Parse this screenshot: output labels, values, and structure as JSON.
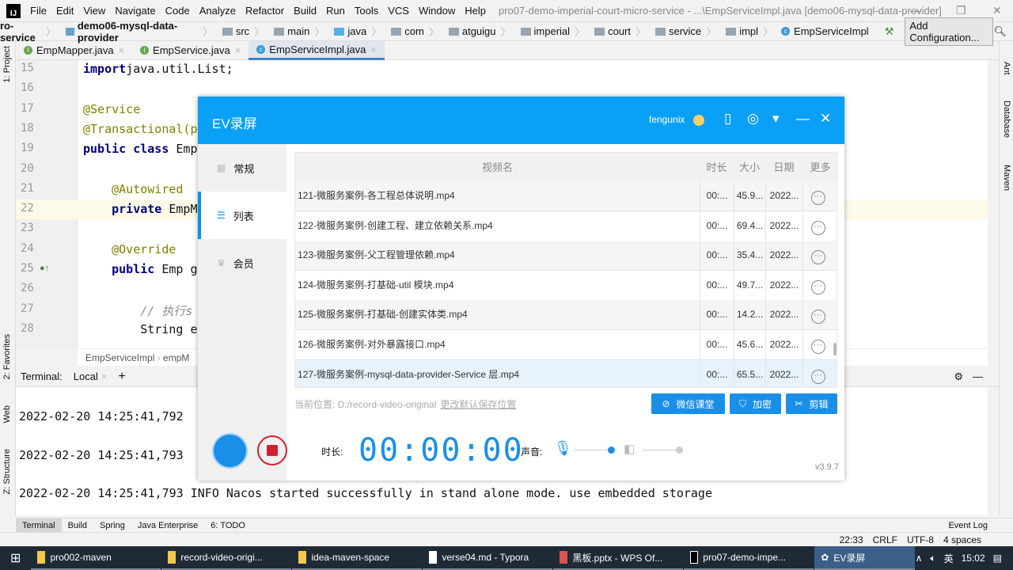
{
  "ide": {
    "menu": [
      "File",
      "Edit",
      "View",
      "Navigate",
      "Code",
      "Analyze",
      "Refactor",
      "Build",
      "Run",
      "Tools",
      "VCS",
      "Window",
      "Help"
    ],
    "window_title": "pro07-demo-imperial-court-micro-service - ...\\EmpServiceImpl.java [demo06-mysql-data-provider]",
    "breadcrumbs": [
      "ro-service",
      "demo06-mysql-data-provider",
      "src",
      "main",
      "java",
      "com",
      "atguigu",
      "imperial",
      "court",
      "service",
      "impl",
      "EmpServiceImpl"
    ],
    "add_configuration": "Add Configuration...",
    "tabs": [
      {
        "label": "EmpMapper.java",
        "color": "#6aa84f"
      },
      {
        "label": "EmpService.java",
        "color": "#6aa84f"
      },
      {
        "label": "EmpServiceImpl.java",
        "color": "#3d9ad6"
      }
    ],
    "left_tools": [
      "1: Project",
      "2: Favorites",
      "Web",
      "Z: Structure"
    ],
    "right_tools": [
      "Ant",
      "Database",
      "Maven"
    ],
    "code": [
      {
        "n": "15",
        "parts": [
          [
            "kw",
            "import"
          ],
          [
            "",
            "java.util.List;"
          ]
        ]
      },
      {
        "n": "16",
        "parts": []
      },
      {
        "n": "17",
        "parts": [
          [
            "ann",
            "@Service"
          ]
        ]
      },
      {
        "n": "18",
        "parts": [
          [
            "ann",
            "@Transactional(p"
          ]
        ]
      },
      {
        "n": "19",
        "parts": [
          [
            "kw",
            "public class"
          ],
          [
            "",
            " Emp"
          ]
        ]
      },
      {
        "n": "20",
        "parts": []
      },
      {
        "n": "21",
        "parts": [
          [
            "ann",
            "    @Autowired"
          ]
        ]
      },
      {
        "n": "22",
        "parts": [
          [
            "kw",
            "    private"
          ],
          [
            "",
            " EmpM"
          ]
        ]
      },
      {
        "n": "23",
        "parts": []
      },
      {
        "n": "24",
        "parts": [
          [
            "ann",
            "    @Override"
          ]
        ]
      },
      {
        "n": "25",
        "parts": [
          [
            "kw",
            "    public"
          ],
          [
            "",
            " Emp g"
          ]
        ]
      },
      {
        "n": "26",
        "parts": []
      },
      {
        "n": "27",
        "parts": [
          [
            "cmt",
            "        // 执行s"
          ]
        ]
      },
      {
        "n": "28",
        "parts": [
          [
            "",
            "        String e"
          ]
        ]
      }
    ],
    "editor_crumbs": [
      "EmpServiceImpl",
      "empM"
    ],
    "terminal_label": "Terminal:",
    "terminal_tab": "Local",
    "terminal_lines": [
      "2022-02-20 14:25:41,792",
      "2022-02-20 14:25:41,793",
      "2022-02-20 14:25:41,793 INFO Nacos started successfully in stand alone mode. use embedded storage"
    ],
    "tool_windows": [
      "Terminal",
      "Build",
      "Spring",
      "Java Enterprise",
      "6: TODO"
    ],
    "event_log": "Event Log",
    "status": [
      "22:33",
      "CRLF",
      "UTF-8",
      "4 spaces"
    ]
  },
  "taskbar": {
    "items": [
      "pro002-maven",
      "record-video-origi...",
      "idea-maven-space",
      "verse04.md - Typora",
      "黑板.pptx - WPS Of...",
      "pro07-demo-impe...",
      "EV录屏"
    ],
    "ime": "英",
    "time": "15:02"
  },
  "ev": {
    "title": "EV录屏",
    "user": "fengunix",
    "sidebar": [
      "常规",
      "列表",
      "会员"
    ],
    "columns": [
      "视频名",
      "时长",
      "大小",
      "日期",
      "更多"
    ],
    "rows": [
      {
        "name": "121-微服务案例-各工程总体说明.mp4",
        "dur": "00:...",
        "size": "45.9...",
        "date": "2022..."
      },
      {
        "name": "122-微服务案例-创建工程、建立依赖关系.mp4",
        "dur": "00:...",
        "size": "69.4...",
        "date": "2022..."
      },
      {
        "name": "123-微服务案例-父工程管理依赖.mp4",
        "dur": "00:...",
        "size": "35.4...",
        "date": "2022..."
      },
      {
        "name": "124-微服务案例-打基础-util 模块.mp4",
        "dur": "00:...",
        "size": "49.7...",
        "date": "2022..."
      },
      {
        "name": "125-微服务案例-打基础-创建实体类.mp4",
        "dur": "00:...",
        "size": "14.2...",
        "date": "2022..."
      },
      {
        "name": "126-微服务案例-对外暴露接口.mp4",
        "dur": "00:...",
        "size": "45.6...",
        "date": "2022..."
      },
      {
        "name": "127-微服务案例-mysql-data-provider-Service 层.mp4",
        "dur": "00:...",
        "size": "65.5...",
        "date": "2022..."
      }
    ],
    "path_label": "当前位置: D:/record-video-original",
    "change_path": "更改默认保存位置",
    "buttons": [
      "微信课堂",
      "加密",
      "剪辑"
    ],
    "duration_label": "时长:",
    "timer": "00:00:00",
    "sound_label": "声音:",
    "mic_level": 1.0,
    "speaker_level": 1.0,
    "version": "v3.9.7",
    "accent": "#0aa0f5"
  }
}
